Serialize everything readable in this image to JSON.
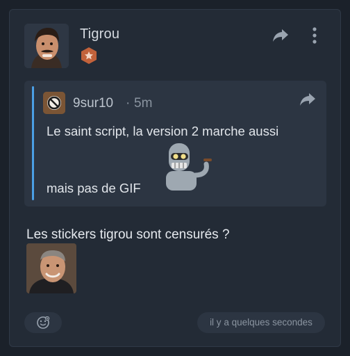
{
  "post": {
    "author": "Tigrou",
    "rank_icon": "star-badge-icon",
    "text": "Les stickers tigrou sont censurés ?",
    "timestamp": "il y a quelques secondes"
  },
  "quote": {
    "author": "9sur10",
    "separator": "·",
    "time": "5m",
    "line1": "Le saint script, la version 2 marche aussi",
    "line2": "mais pas de GIF"
  },
  "colors": {
    "background": "#1b212a",
    "card": "#232b36",
    "quote_bg": "#2c3542",
    "quote_bar": "#4b9fe5",
    "rank_badge": "#c2623b"
  }
}
